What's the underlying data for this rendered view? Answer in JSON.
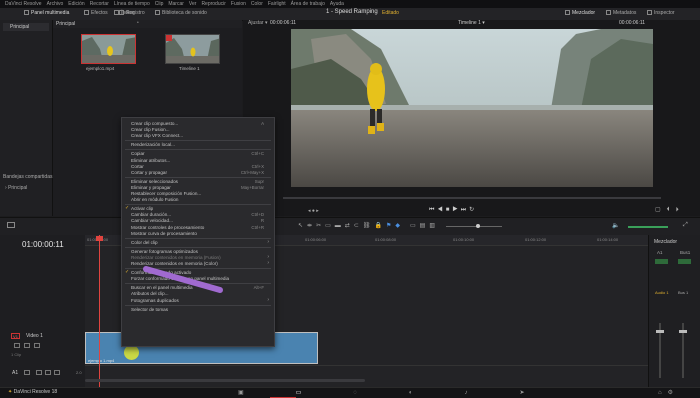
{
  "menubar": {
    "items": [
      "DaVinci Resolve",
      "Archivo",
      "Edición",
      "Recortar",
      "Línea de tiempo",
      "Clip",
      "Marcar",
      "Ver",
      "Reproducir",
      "Fusion",
      "Color",
      "Fairlight",
      "Área de trabajo",
      "Ayuda"
    ]
  },
  "toolbar": {
    "media_pool": "Panel multimedia",
    "effects": "Efectos",
    "index": "Índice",
    "edit_index": "Registro",
    "sound_library": "Biblioteca de sonido",
    "project_title": "1 - Speed Ramping",
    "edited": "Editado",
    "mixer": "Mezclador",
    "metadata": "Metadatos",
    "inspector": "Inspector"
  },
  "left_panel": {
    "main_label": "Principal",
    "shared_bins": "Bandejas compartidas",
    "shared_main": "Principal"
  },
  "media_pool": {
    "header": "Principal",
    "clips": [
      {
        "name": "ejemplo1.mp4"
      },
      {
        "name": "Timeline 1"
      }
    ]
  },
  "viewer": {
    "zoom": "Ajustar",
    "timecode_src": "00:00:06:11",
    "timeline_name": "Timeline 1",
    "timecode_rec": "00:00:06:11"
  },
  "timeline": {
    "timecode": "01:00:00:11",
    "ruler_ticks": [
      "01:00:00:00",
      "01:00:04:00",
      "01:00:06:00",
      "01:00:08:00",
      "01:00:10:00",
      "01:00:12:00",
      "01:00:14:00"
    ],
    "video_track": {
      "id": "V1",
      "name": "Video 1",
      "clip_count": "1 Clip"
    },
    "audio_track": {
      "id": "A1",
      "level": "2.0"
    },
    "clip_label": "ejemplo 1.mp4"
  },
  "mixer": {
    "title": "Mezclador",
    "channels": [
      "A1",
      "Bus1"
    ],
    "audio_label": "Audio 1",
    "bus_label": "Bus 1"
  },
  "context_menu": {
    "items": [
      {
        "label": "Crear clip compuesto...",
        "shortcut": "A",
        "disabled": false
      },
      {
        "label": "Crear clip Fusion...",
        "shortcut": "",
        "disabled": false
      },
      {
        "label": "Crear clip VFX Connect...",
        "shortcut": "",
        "disabled": false
      },
      {
        "sep": true
      },
      {
        "label": "Renderización local...",
        "shortcut": "",
        "disabled": false
      },
      {
        "sep": true
      },
      {
        "label": "Copiar",
        "shortcut": "Ctrl+C",
        "disabled": false
      },
      {
        "label": "Eliminar atributos...",
        "shortcut": "",
        "disabled": false
      },
      {
        "label": "Cortar",
        "shortcut": "Ctrl+X",
        "disabled": false
      },
      {
        "label": "Cortar y propagar",
        "shortcut": "Ctrl+May+X",
        "disabled": false
      },
      {
        "sep": true
      },
      {
        "label": "Eliminar seleccionados",
        "shortcut": "Supr",
        "disabled": false
      },
      {
        "label": "Eliminar y propagar",
        "shortcut": "May+Borrar",
        "disabled": false
      },
      {
        "label": "Restablecer composición Fusion...",
        "shortcut": "",
        "disabled": false
      },
      {
        "label": "Abrir en módulo Fusion",
        "shortcut": "",
        "disabled": false
      },
      {
        "sep": true
      },
      {
        "label": "Activar clip",
        "shortcut": "",
        "disabled": false,
        "checked": true
      },
      {
        "label": "Cambiar duración...",
        "shortcut": "Ctrl+D",
        "disabled": false
      },
      {
        "label": "Cambiar velocidad...",
        "shortcut": "R",
        "disabled": false
      },
      {
        "label": "Mostrar controles de procesamiento",
        "shortcut": "Ctrl+R",
        "disabled": false
      },
      {
        "label": "Mostrar curva de procesamiento",
        "shortcut": "",
        "disabled": false
      },
      {
        "sep": true
      },
      {
        "label": "Color del clip",
        "shortcut": "",
        "disabled": false,
        "submenu": true
      },
      {
        "sep": true
      },
      {
        "label": "Generar fotogramas optimizados",
        "shortcut": "",
        "disabled": false
      },
      {
        "label": "Renderizar contenidos en memoria (Fusion)",
        "shortcut": "",
        "disabled": true,
        "submenu": true
      },
      {
        "label": "Renderizar contenidos en memoria (Color)",
        "shortcut": "",
        "disabled": false,
        "submenu": true
      },
      {
        "sep": true
      },
      {
        "label": "Conformado forzado activado",
        "shortcut": "",
        "disabled": false,
        "checked": true
      },
      {
        "label": "Forzar conformado con clip en panel multimedia",
        "shortcut": "",
        "disabled": false
      },
      {
        "sep": true
      },
      {
        "label": "Buscar en el panel multimedia",
        "shortcut": "Alt+F",
        "disabled": false
      },
      {
        "label": "Atributos del clip...",
        "shortcut": "",
        "disabled": false
      },
      {
        "label": "Fotogramas duplicados",
        "shortcut": "",
        "disabled": false,
        "submenu": true
      },
      {
        "sep": true
      },
      {
        "label": "Selector de tomas",
        "shortcut": "",
        "disabled": false
      }
    ]
  },
  "bottombar": {
    "app_name": "DaVinci Resolve 18"
  },
  "colors": {
    "accent": "#e0b030",
    "clip_blue": "#4a83b0",
    "playhead": "#e0443f",
    "cursor_highlight": "#d8e23a",
    "annotation_purple": "#a06ad0"
  }
}
